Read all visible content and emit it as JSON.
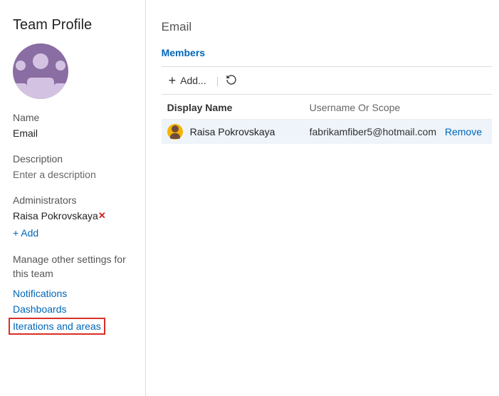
{
  "sidebar": {
    "title": "Team Profile",
    "name_label": "Name",
    "name_value": "Email",
    "description_label": "Description",
    "description_placeholder": "Enter a description",
    "admins_label": "Administrators",
    "admins": [
      {
        "name": "Raisa Pokrovskaya"
      }
    ],
    "add_label": "+ Add",
    "manage_label": "Manage other settings for this team",
    "links": {
      "notifications": "Notifications",
      "dashboards": "Dashboards",
      "iterations": "Iterations and areas"
    }
  },
  "main": {
    "title": "Email",
    "tab_members": "Members",
    "toolbar": {
      "add_label": "Add..."
    },
    "table": {
      "col_name": "Display Name",
      "col_user": "Username Or Scope",
      "rows": [
        {
          "name": "Raisa Pokrovskaya",
          "user": "fabrikamfiber5@hotmail.com",
          "remove": "Remove"
        }
      ]
    }
  }
}
